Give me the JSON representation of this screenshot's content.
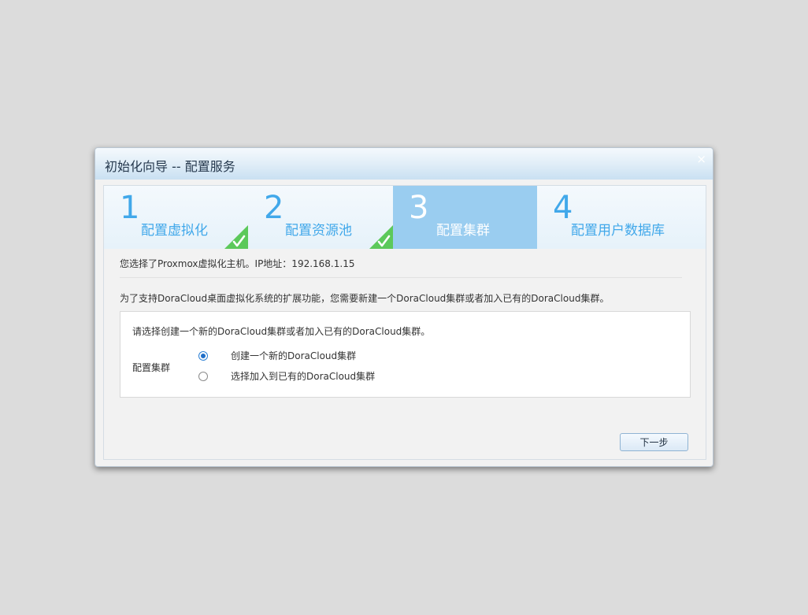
{
  "dialog": {
    "title": "初始化向导 -- 配置服务",
    "close_icon": "×"
  },
  "steps": [
    {
      "number": "1",
      "label": "配置虚拟化",
      "state": "completed"
    },
    {
      "number": "2",
      "label": "配置资源池",
      "state": "completed"
    },
    {
      "number": "3",
      "label": "配置集群",
      "state": "active"
    },
    {
      "number": "4",
      "label": "配置用户数据库",
      "state": "pending"
    }
  ],
  "info": {
    "selected_host": "您选择了Proxmox虚拟化主机。IP地址：192.168.1.15"
  },
  "description": "为了支持DoraCloud桌面虚拟化系统的扩展功能，您需要新建一个DoraCloud集群或者加入已有的DoraCloud集群。",
  "cluster_box": {
    "prompt": "请选择创建一个新的DoraCloud集群或者加入已有的DoraCloud集群。",
    "field_label": "配置集群",
    "options": [
      {
        "label": "创建一个新的DoraCloud集群",
        "checked": true
      },
      {
        "label": "选择加入到已有的DoraCloud集群",
        "checked": false
      }
    ]
  },
  "footer": {
    "next_label": "下一步"
  },
  "colors": {
    "accent": "#41a8ea",
    "active_step_bg": "#9acdf0",
    "check_green": "#5cc95b"
  }
}
